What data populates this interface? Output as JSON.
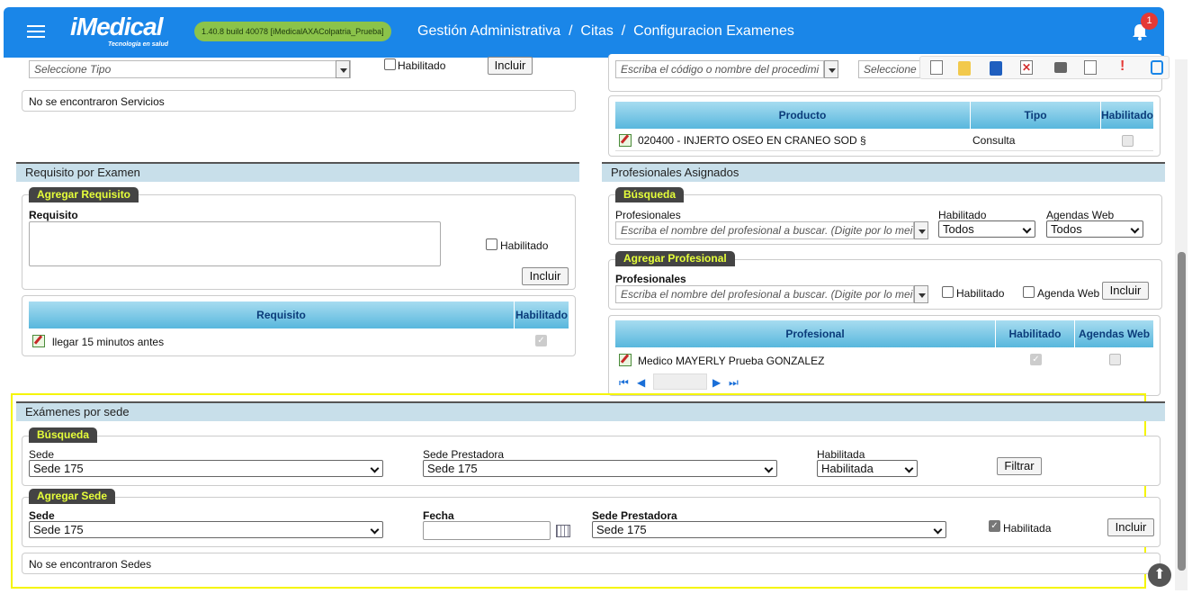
{
  "header": {
    "app_name": "iMedical",
    "tagline": "Tecnología en salud",
    "version": "1.40.8 build 40078 [iMedicalAXAColpatria_Prueba]",
    "breadcrumb": "Gestión Administrativa  /  Citas  /  Configuracion Examenes",
    "notifications": "1"
  },
  "services": {
    "tipo_placeholder": "Seleccione Tipo",
    "habilitado": "Habilitado",
    "incluir": "Incluir",
    "empty": "No se encontraron Servicios"
  },
  "procedure": {
    "placeholder": "Escriba el código o nombre del procedimi",
    "select_placeholder": "Seleccione",
    "columns": [
      "Producto",
      "Tipo",
      "Habilitado"
    ],
    "rows": [
      {
        "producto": "020400 - INJERTO OSEO EN CRANEO SOD §",
        "tipo": "Consulta"
      }
    ]
  },
  "requisitos": {
    "title": "Requisito por Examen",
    "tag": "Agregar Requisito",
    "label": "Requisito",
    "habilitado": "Habilitado",
    "incluir": "Incluir",
    "columns": [
      "Requisito",
      "Habilitado"
    ],
    "rows": [
      {
        "requisito": "llegar 15 minutos antes"
      }
    ]
  },
  "profesionales": {
    "title": "Profesionales Asignados",
    "search_tag": "Búsqueda",
    "add_tag": "Agregar Profesional",
    "prof_label": "Profesionales",
    "placeholder": "Escriba el nombre del profesional a buscar. (Digite por lo mei",
    "habilitado_label": "Habilitado",
    "agendas_label": "Agendas Web",
    "habilitado_value": "Todos",
    "agendas_value": "Todos",
    "habilitado": "Habilitado",
    "agenda_web": "Agenda Web",
    "incluir": "Incluir",
    "columns": [
      "Profesional",
      "Habilitado",
      "Agendas Web"
    ],
    "rows": [
      {
        "profesional": "Medico MAYERLY Prueba GONZALEZ"
      }
    ]
  },
  "sedes": {
    "title": "Exámenes por sede",
    "search_tag": "Búsqueda",
    "add_tag": "Agregar Sede",
    "sede_label": "Sede",
    "sede_prestadora_label": "Sede Prestadora",
    "habilitada_label": "Habilitada",
    "fecha_label": "Fecha",
    "sede_value": "Sede 175",
    "sede_prestadora_value": "Sede 175",
    "habilitada_value": "Habilitada",
    "filtrar": "Filtrar",
    "habilitada_cb": "Habilitada",
    "incluir": "Incluir",
    "empty": "No se encontraron Sedes"
  }
}
